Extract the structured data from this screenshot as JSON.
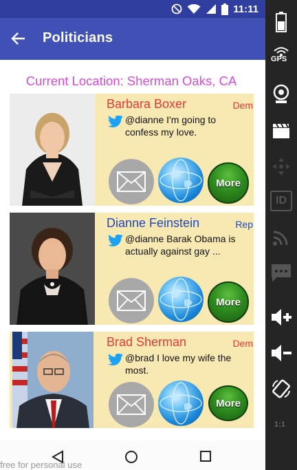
{
  "status_bar": {
    "time": "11:11"
  },
  "app_bar": {
    "title": "Politicians"
  },
  "location": {
    "text": "Current Location: Sherman Oaks, CA"
  },
  "politicians": [
    {
      "name": "Barbara Boxer",
      "party": "Dem",
      "tweet": "@dianne I'm going to confess my love.",
      "more_label": "More"
    },
    {
      "name": "Dianne Feinstein",
      "party": "Rep",
      "tweet": "@dianne Barak Obama is actually against gay ...",
      "more_label": "More"
    },
    {
      "name": "Brad Sherman",
      "party": "Dem",
      "tweet": "@brad I love my wife the most.",
      "more_label": "More"
    }
  ],
  "side_panel": {
    "gps_label": "GPS",
    "id_label": "ID",
    "scale_label": "1:1"
  },
  "watermark": "free for personal use",
  "colors": {
    "status_bar": "#303f9f",
    "app_bar": "#3f51b5",
    "location_text": "#d64bd6",
    "card_bg": "#f8e9b2",
    "dem": "#e53935",
    "rep": "#1e47c8",
    "more_button": "#2f8d1f"
  },
  "icons": [
    "no-disturb-icon",
    "wifi-icon",
    "signal-icon",
    "battery-icon",
    "back-arrow-icon",
    "twitter-bird-icon",
    "mail-icon",
    "globe-icon",
    "nav-back-icon",
    "nav-home-icon",
    "nav-recents-icon"
  ]
}
